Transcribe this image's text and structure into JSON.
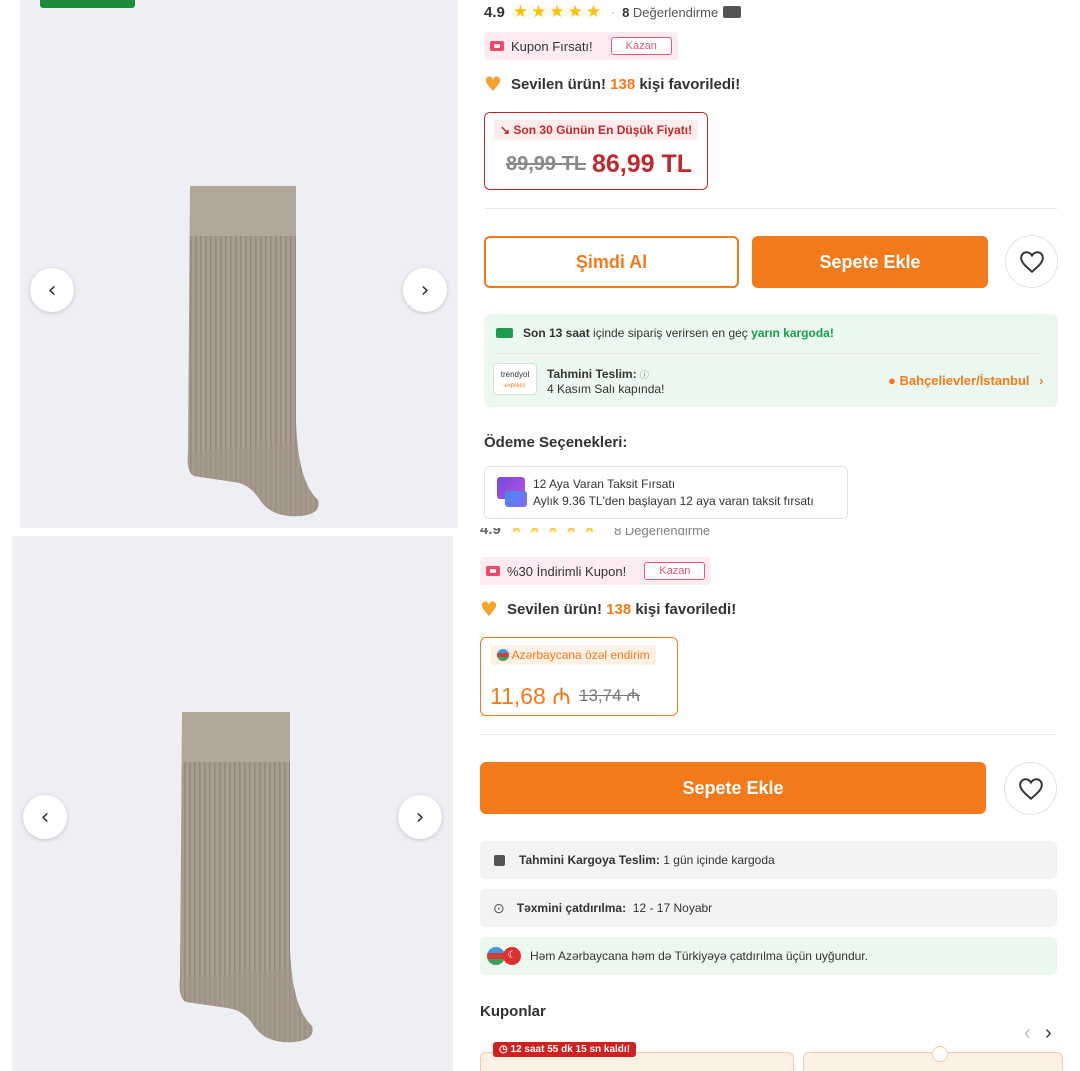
{
  "top": {
    "rating": "4.9",
    "stars": "★★★★★",
    "review_count": "8",
    "review_label": "Değerlendirme",
    "coupon_label": "Kupon Fırsatı!",
    "kazan_label": "Kazan",
    "fav_prefix": "Sevilen ürün!",
    "fav_count": "138",
    "fav_suffix": "kişi favoriledi!",
    "price_tag": "Son 30 Günün En Düşük Fiyatı!",
    "old_price": "89,99 TL",
    "new_price": "86,99 TL",
    "buy_now": "Şimdi Al",
    "add_to_cart": "Sepete Ekle",
    "ship_prefix": "Son 13 saat",
    "ship_middle": "içinde sipariş verirsen en geç",
    "ship_highlight": "yarın kargoda!",
    "logo_name": "trendyol",
    "logo_sub": "express",
    "delivery_title": "Tahmini Teslim:",
    "delivery_date": "4 Kasım Salı kapında!",
    "location": "Bahçelievler/İstanbul",
    "payment_title": "Ödeme Seçenekleri:",
    "installment_title": "12 Aya Varan Taksit Fırsatı",
    "installment_desc": "Aylık 9.36 TL'den başlayan 12 aya varan taksit fırsatı"
  },
  "bottom": {
    "rating_partial": "4.9",
    "review_partial": "8 Değerlendirme",
    "coupon_label": "%30 İndirimli Kupon!",
    "kazan_label": "Kazan",
    "fav_prefix": "Sevilen ürün!",
    "fav_count": "138",
    "fav_suffix": "kişi favoriledi!",
    "az_tag": "Azərbaycana özəl endirim",
    "new_price": "11,68 ₼",
    "old_price": "13,74 ₼",
    "add_to_cart": "Sepete Ekle",
    "cargo_label": "Tahmini Kargoya Teslim:",
    "cargo_value": "1 gün içinde kargoda",
    "delivery_label": "Təxmini çatdırılma:",
    "delivery_value": "12 - 17 Noyabr",
    "both_countries": "Həm Azərbaycana həm də Türkiyəyə çatdırılma üçün uyğundur.",
    "coupons_title": "Kuponlar",
    "timer": "12 saat 55 dk 15 sn kaldı!"
  },
  "colors": {
    "brand_orange": "#f27a1a",
    "price_red": "#c0282d",
    "success_green": "#1b9e4b"
  },
  "icons": [
    "chevron-left-icon",
    "chevron-right-icon",
    "heart-icon",
    "truck-icon",
    "location-pin-icon",
    "camera-icon",
    "coupon-icon",
    "credit-card-icon",
    "box-icon",
    "clock-icon"
  ]
}
